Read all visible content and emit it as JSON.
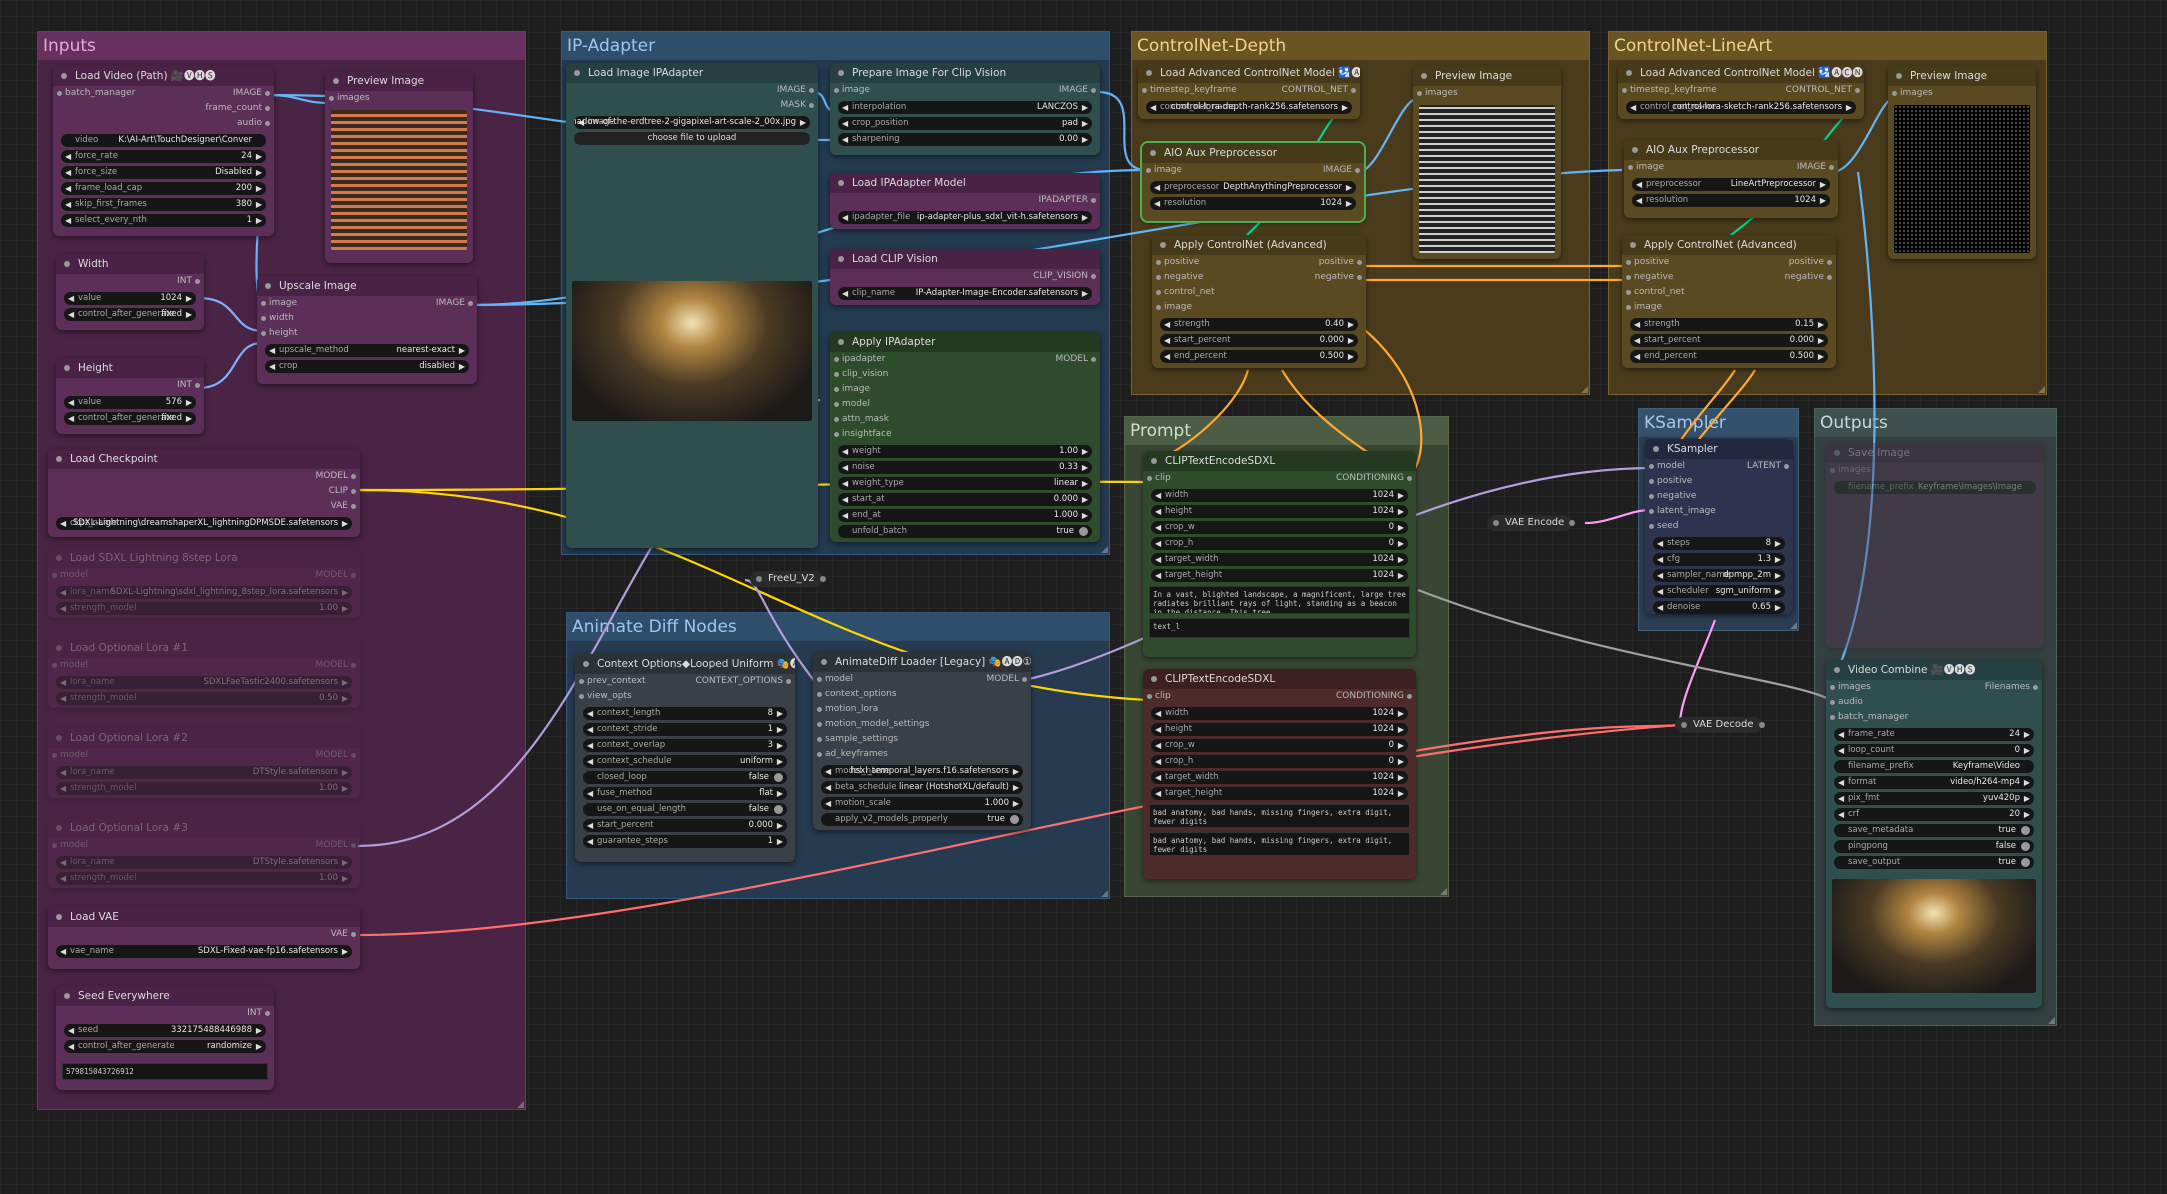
{
  "groups": {
    "inputs": "Inputs",
    "ipadapter": "IP-Adapter",
    "cn_depth": "ControlNet-Depth",
    "cn_lineart": "ControlNet-LineArt",
    "prompt": "Prompt",
    "animdiff": "Animate Diff Nodes",
    "ksampler": "KSampler",
    "outputs": "Outputs"
  },
  "load_video": {
    "title": "Load Video (Path) 🎥🅥🅗🅢",
    "in_batch": "batch_manager",
    "out_image": "IMAGE",
    "out_frame_count": "frame_count",
    "out_audio": "audio",
    "video_label": "video",
    "video": "K:\\AI-Art\\TouchDesigner\\Conver",
    "force_rate_label": "force_rate",
    "force_rate": "24",
    "force_size_label": "force_size",
    "force_size": "Disabled",
    "frame_load_cap_label": "frame_load_cap",
    "frame_load_cap": "200",
    "skip_first_frames_label": "skip_first_frames",
    "skip_first_frames": "380",
    "select_every_nth_label": "select_every_nth",
    "select_every_nth": "1"
  },
  "preview_image_1": {
    "title": "Preview Image",
    "in_images": "images"
  },
  "width": {
    "title": "Width",
    "out": "INT",
    "value_label": "value",
    "value": "1024",
    "cag_label": "control_after_generate",
    "cag": "fixed"
  },
  "height": {
    "title": "Height",
    "out": "INT",
    "value_label": "value",
    "value": "576",
    "cag_label": "control_after_generate",
    "cag": "fixed"
  },
  "upscale": {
    "title": "Upscale Image",
    "in_image": "image",
    "in_width": "width",
    "in_height": "height",
    "out_image": "IMAGE",
    "method_label": "upscale_method",
    "method": "nearest-exact",
    "crop_label": "crop",
    "crop": "disabled"
  },
  "load_checkpoint": {
    "title": "Load Checkpoint",
    "out_model": "MODEL",
    "out_clip": "CLIP",
    "out_vae": "VAE",
    "ckpt_label": "ckpt_name",
    "ckpt": "SDXL-Lightning\\dreamshaperXL_lightningDPMSDE.safetensors"
  },
  "lora_sdxl": {
    "title": "Load SDXL Lightning 8step Lora",
    "in_model": "model",
    "out_model": "MODEL",
    "lora_label": "lora_name",
    "lora": "SDXL-Lightning\\sdxl_lightning_8step_lora.safetensors",
    "strength_label": "strength_model",
    "strength": "1.00"
  },
  "lora_1": {
    "title": "Load Optional Lora #1",
    "in_model": "model",
    "out_model": "MODEL",
    "lora_label": "lora_name",
    "lora": "SDXLFaeTastic2400.safetensors",
    "strength_label": "strength_model",
    "strength": "0.50"
  },
  "lora_2": {
    "title": "Load Optional Lora #2",
    "in_model": "model",
    "out_model": "MODEL",
    "lora_label": "lora_name",
    "lora": "DTStyle.safetensors",
    "strength_label": "strength_model",
    "strength": "1.00"
  },
  "lora_3": {
    "title": "Load Optional Lora #3",
    "in_model": "model",
    "out_model": "MODEL",
    "lora_label": "lora_name",
    "lora": "DTStyle.safetensors",
    "strength_label": "strength_model",
    "strength": "1.00"
  },
  "load_vae": {
    "title": "Load VAE",
    "out_vae": "VAE",
    "vae_label": "vae_name",
    "vae": "SDXL-Fixed-vae-fp16.safetensors"
  },
  "seed_everywhere": {
    "title": "Seed Everywhere",
    "out": "INT",
    "seed_label": "seed",
    "seed": "332175488446988",
    "cag_label": "control_after_generate",
    "cag": "randomize",
    "display": "579815043726912"
  },
  "load_image_ipa": {
    "title": "Load Image IPAdapter",
    "out_image": "IMAGE",
    "out_mask": "MASK",
    "image_label": "image",
    "image": "elden-ring-shadow-of-the-erdtree-2-gigapixel-art-scale-2_00x.jpg",
    "upload": "choose file to upload"
  },
  "prep_clip_vision": {
    "title": "Prepare Image For Clip Vision",
    "in_image": "image",
    "out_image": "IMAGE",
    "interp_label": "interpolation",
    "interp": "LANCZOS",
    "crop_label": "crop_position",
    "crop": "pad",
    "sharp_label": "sharpening",
    "sharp": "0.00"
  },
  "load_ipa_model": {
    "title": "Load IPAdapter Model",
    "out": "IPADAPTER",
    "file_label": "ipadapter_file",
    "file": "ip-adapter-plus_sdxl_vit-h.safetensors"
  },
  "load_clip_vision": {
    "title": "Load CLIP Vision",
    "out": "CLIP_VISION",
    "name_label": "clip_name",
    "name": "IP-Adapter-Image-Encoder.safetensors"
  },
  "apply_ipa": {
    "title": "Apply IPAdapter",
    "in": [
      "ipadapter",
      "clip_vision",
      "image",
      "model",
      "attn_mask",
      "insightface"
    ],
    "out_model": "MODEL",
    "weight_label": "weight",
    "weight": "1.00",
    "noise_label": "noise",
    "noise": "0.33",
    "wtype_label": "weight_type",
    "wtype": "linear",
    "start_label": "start_at",
    "start": "0.000",
    "end_label": "end_at",
    "end": "1.000",
    "unfold_label": "unfold_batch",
    "unfold": "true"
  },
  "freeu": {
    "title": "FreeU_V2"
  },
  "cn_depth_loader": {
    "title": "Load Advanced ControlNet Model 🛂🅐🅒🅝",
    "in": "timestep_keyframe",
    "out": "CONTROL_NET",
    "name_label": "control_net_name",
    "name": "control-lora-depth-rank256.safetensors"
  },
  "cn_depth_aio": {
    "title": "AIO Aux Preprocessor",
    "in": "image",
    "out": "IMAGE",
    "pre_label": "preprocessor",
    "pre": "DepthAnythingPreprocessor",
    "res_label": "resolution",
    "res": "1024"
  },
  "cn_depth_preview": {
    "title": "Preview Image",
    "in": "images"
  },
  "cn_depth_apply": {
    "title": "Apply ControlNet (Advanced)",
    "in": [
      "positive",
      "negative",
      "control_net",
      "image"
    ],
    "out_pos": "positive",
    "out_neg": "negative",
    "strength_label": "strength",
    "strength": "0.40",
    "start_label": "start_percent",
    "start": "0.000",
    "end_label": "end_percent",
    "end": "0.500"
  },
  "cn_line_loader": {
    "title": "Load Advanced ControlNet Model 🛂🅐🅒🅝",
    "in": "timestep_keyframe",
    "out": "CONTROL_NET",
    "name_label": "control_net_name",
    "name": "control-lora-sketch-rank256.safetensors"
  },
  "cn_line_aio": {
    "title": "AIO Aux Preprocessor",
    "in": "image",
    "out": "IMAGE",
    "pre_label": "preprocessor",
    "pre": "LineArtPreprocessor",
    "res_label": "resolution",
    "res": "1024"
  },
  "cn_line_preview": {
    "title": "Preview Image",
    "in": "images"
  },
  "cn_line_apply": {
    "title": "Apply ControlNet (Advanced)",
    "in": [
      "positive",
      "negative",
      "control_net",
      "image"
    ],
    "out_pos": "positive",
    "out_neg": "negative",
    "strength_label": "strength",
    "strength": "0.15",
    "start_label": "start_percent",
    "start": "0.000",
    "end_label": "end_percent",
    "end": "0.500"
  },
  "clip_pos": {
    "title": "CLIPTextEncodeSDXL",
    "in_clip": "clip",
    "out": "CONDITIONING",
    "width_label": "width",
    "width": "1024",
    "height_label": "height",
    "height": "1024",
    "cropw_label": "crop_w",
    "cropw": "0",
    "croph_label": "crop_h",
    "croph": "0",
    "tw_label": "target_width",
    "tw": "1024",
    "th_label": "target_height",
    "th": "1024",
    "text_g": "In a vast, blighted landscape, a magnificent, large tree radiates brilliant rays of light, standing as a beacon in the distance. This tree,",
    "text_l": "text_l"
  },
  "clip_neg": {
    "title": "CLIPTextEncodeSDXL",
    "in_clip": "clip",
    "out": "CONDITIONING",
    "width_label": "width",
    "width": "1024",
    "height_label": "height",
    "height": "1024",
    "cropw_label": "crop_w",
    "cropw": "0",
    "croph_label": "crop_h",
    "croph": "0",
    "tw_label": "target_width",
    "tw": "1024",
    "th_label": "target_height",
    "th": "1024",
    "text_g": "bad anatomy, bad hands, missing fingers, extra digit, fewer digits",
    "text_l": "bad anatomy, bad hands, missing fingers, extra digit, fewer digits"
  },
  "context_opts": {
    "title": "Context Options◆Looped Uniform 🎭🅐🅓",
    "in_prev": "prev_context",
    "in_view": "view_opts",
    "out": "CONTEXT_OPTIONS",
    "len_label": "context_length",
    "len": "8",
    "stride_label": "context_stride",
    "stride": "1",
    "overlap_label": "context_overlap",
    "overlap": "3",
    "sched_label": "context_schedule",
    "sched": "uniform",
    "closed_label": "closed_loop",
    "closed": "false",
    "fuse_label": "fuse_method",
    "fuse": "flat",
    "equal_label": "use_on_equal_length",
    "equal": "false",
    "start_label": "start_percent",
    "start": "0.000",
    "guar_label": "guarantee_steps",
    "guar": "1"
  },
  "animdiff_loader": {
    "title": "AnimateDiff Loader [Legacy] 🎭🅐🅓①",
    "in": [
      "model",
      "context_options",
      "motion_lora",
      "motion_model_settings",
      "sample_settings",
      "ad_keyframes"
    ],
    "out": "MODEL",
    "model_label": "model_name",
    "model": "hsxl_temporal_layers.f16.safetensors",
    "beta_label": "beta_schedule",
    "beta": "linear (HotshotXL/default)",
    "scale_label": "motion_scale",
    "scale": "1.000",
    "v2_label": "apply_v2_models_properly",
    "v2": "true"
  },
  "ksampler": {
    "title": "KSampler",
    "in": [
      "model",
      "positive",
      "negative",
      "latent_image",
      "seed"
    ],
    "out": "LATENT",
    "steps_label": "steps",
    "steps": "8",
    "cfg_label": "cfg",
    "cfg": "1.3",
    "sampler_label": "sampler_name",
    "sampler": "dpmpp_2m",
    "sched_label": "scheduler",
    "sched": "sgm_uniform",
    "denoise_label": "denoise",
    "denoise": "0.65"
  },
  "vae_encode": {
    "title": "VAE Encode"
  },
  "vae_decode": {
    "title": "VAE Decode"
  },
  "save_image": {
    "title": "Save Image",
    "in": "images",
    "prefix_label": "filename_prefix",
    "prefix": "Keyframe\\Images\\Image"
  },
  "video_combine": {
    "title": "Video Combine 🎥🅥🅗🅢",
    "in": [
      "images",
      "audio",
      "batch_manager"
    ],
    "out": "Filenames",
    "fr_label": "frame_rate",
    "fr": "24",
    "loop_label": "loop_count",
    "loop": "0",
    "prefix_label": "filename_prefix",
    "prefix": "Keyframe\\Video",
    "format_label": "format",
    "format": "video/h264-mp4",
    "pix_label": "pix_fmt",
    "pix": "yuv420p",
    "crf_label": "crf",
    "crf": "20",
    "meta_label": "save_metadata",
    "meta": "true",
    "ping_label": "pingpong",
    "ping": "false",
    "saveout_label": "save_output",
    "saveout": "true"
  },
  "colors": {
    "model": "#b39ddb",
    "clip": "#ffd500",
    "vae": "#ff6e6e",
    "image": "#64b5f6",
    "conditioning": "#ffa931",
    "control_net": "#00d78d",
    "latent": "#ff9cf9",
    "int": "#7fb0ff"
  }
}
